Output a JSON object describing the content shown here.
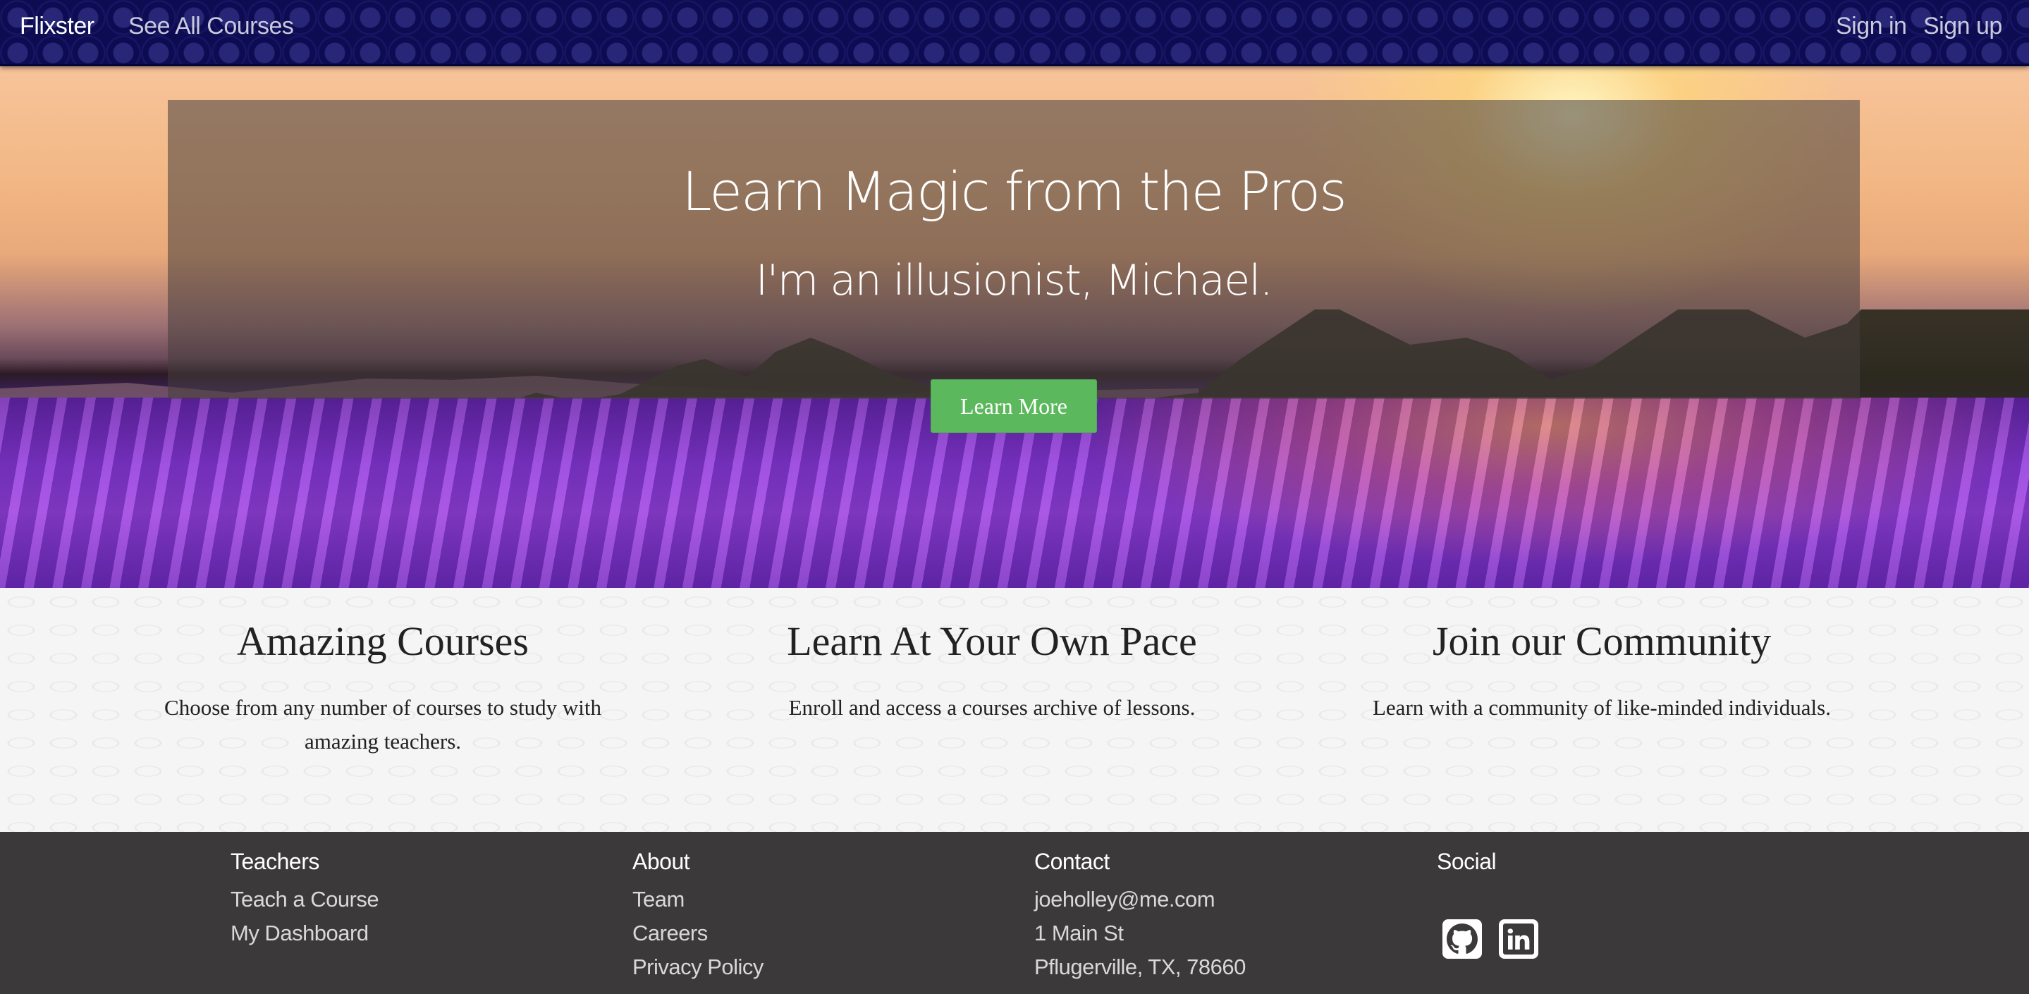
{
  "nav": {
    "brand": "Flixster",
    "all_courses": "See All Courses",
    "sign_in": "Sign in",
    "sign_up": "Sign up"
  },
  "hero": {
    "title": "Learn Magic from the Pros",
    "subtitle": "I'm an illusionist, Michael.",
    "button_label": "Learn More",
    "button_color": "#5cb85c"
  },
  "features": [
    {
      "title": "Amazing Courses",
      "text": "Choose from any number of courses to study with amazing teachers."
    },
    {
      "title": "Learn At Your Own Pace",
      "text": "Enroll and access a courses archive of lessons."
    },
    {
      "title": "Join our Community",
      "text": "Learn with a community of like-minded individuals."
    }
  ],
  "footer": {
    "teachers": {
      "heading": "Teachers",
      "links": [
        "Teach a Course",
        "My Dashboard"
      ]
    },
    "about": {
      "heading": "About",
      "links": [
        "Team",
        "Careers",
        "Privacy Policy"
      ]
    },
    "contact": {
      "heading": "Contact",
      "lines": [
        "joeholley@me.com",
        "1 Main St",
        "Pflugerville, TX, 78660"
      ]
    },
    "social": {
      "heading": "Social",
      "icons": [
        "github-icon",
        "linkedin-icon"
      ]
    }
  },
  "colors": {
    "navbar": "#0d0b52",
    "footer": "#3b393a",
    "accent_green": "#5cb85c"
  }
}
